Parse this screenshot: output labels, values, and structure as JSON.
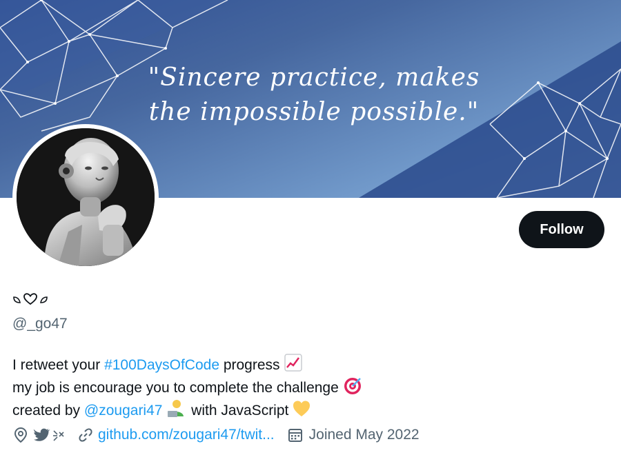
{
  "banner": {
    "quote_line1": "\"Sincere practice, makes",
    "quote_line2": "the impossible possible.\""
  },
  "follow_label": "Follow",
  "profile": {
    "display_name_icons": [
      "leaf-icon",
      "heart-outline-icon",
      "leaf-icon"
    ],
    "handle": "@_go47"
  },
  "bio": {
    "line1_prefix": "I retweet your ",
    "line1_hashtag": "#100DaysOfCode",
    "line1_suffix": " progress",
    "line2": "my job is encourage you to complete the challenge",
    "line3_prefix": "created by ",
    "line3_mention": "@zougari47",
    "line3_suffix": " with JavaScript"
  },
  "meta": {
    "location_icons": [
      "twitter-bird-icon",
      "sparkle-icon"
    ],
    "link": "github.com/zougari47/twit...",
    "joined": "Joined May 2022"
  },
  "colors": {
    "accent": "#1d9bf0",
    "text": "#0f1419",
    "muted": "#536471",
    "button": "#0f1419"
  }
}
